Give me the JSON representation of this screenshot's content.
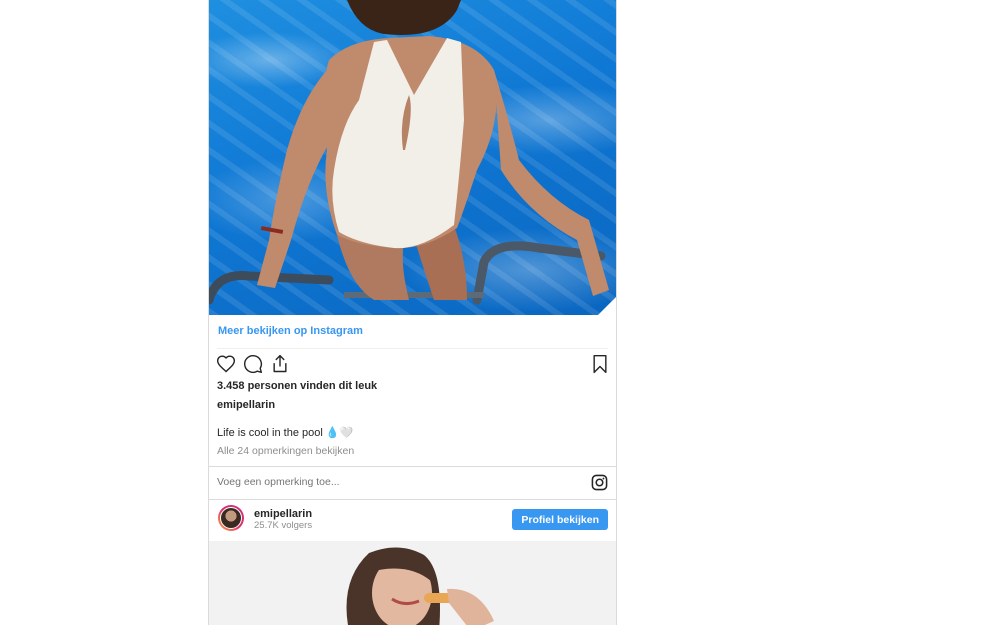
{
  "post": {
    "more_link": "Meer bekijken op Instagram",
    "likes": "3.458 personen vinden dit leuk",
    "username": "emipellarin",
    "caption": "Life is cool in the pool 💧🤍",
    "view_comments": "Alle 24 opmerkingen bekijken",
    "comment_placeholder": "Voeg een opmerking toe..."
  },
  "profile": {
    "username": "emipellarin",
    "followers": "25.7K volgers",
    "button_label": "Profiel bekijken"
  },
  "icons": {
    "like": "heart-icon",
    "comment": "comment-icon",
    "share": "share-icon",
    "save": "bookmark-icon",
    "instagram": "instagram-icon"
  },
  "colors": {
    "link": "#3897f0",
    "button": "#3897f0",
    "muted": "#8e8e8e",
    "text": "#262626"
  }
}
